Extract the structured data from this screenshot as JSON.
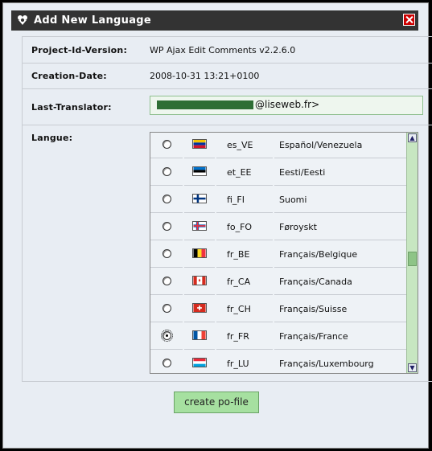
{
  "dialog": {
    "title": "Add New Language",
    "icon": "language-icon"
  },
  "fields": {
    "project_label": "Project-Id-Version:",
    "project_value": "WP Ajax Edit Comments v2.2.6.0",
    "creation_label": "Creation-Date:",
    "creation_value": "2008-10-31 13:21+0100",
    "translator_label": "Last-Translator:",
    "translator_value_visible": "@liseweb.fr>",
    "langue_label": "Langue:"
  },
  "languages": [
    {
      "code": "es_VE",
      "name": "Español/Venezuela",
      "flag": "venezuela-flag",
      "selected": false
    },
    {
      "code": "et_EE",
      "name": "Eesti/Eesti",
      "flag": "estonia-flag",
      "selected": false
    },
    {
      "code": "fi_FI",
      "name": "Suomi",
      "flag": "finland-flag",
      "selected": false
    },
    {
      "code": "fo_FO",
      "name": "Føroyskt",
      "flag": "faroe-flag",
      "selected": false
    },
    {
      "code": "fr_BE",
      "name": "Français/Belgique",
      "flag": "belgium-flag",
      "selected": false
    },
    {
      "code": "fr_CA",
      "name": "Français/Canada",
      "flag": "canada-flag",
      "selected": false
    },
    {
      "code": "fr_CH",
      "name": "Français/Suisse",
      "flag": "switzerland-flag",
      "selected": false
    },
    {
      "code": "fr_FR",
      "name": "Français/France",
      "flag": "france-flag",
      "selected": true
    },
    {
      "code": "fr_LU",
      "name": "Français/Luxembourg",
      "flag": "luxembourg-flag",
      "selected": false
    }
  ],
  "actions": {
    "create_label": "create po-file"
  },
  "colors": {
    "titlebar": "#333333",
    "close": "#cc0000",
    "button": "#a6e0a0",
    "scrollbar": "#c7e6c1"
  }
}
